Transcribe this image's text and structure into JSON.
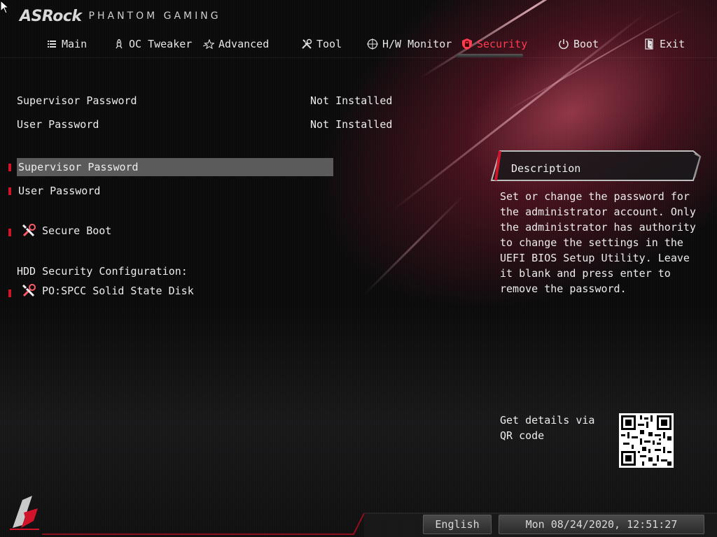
{
  "branding": {
    "name": "ASRock",
    "subtitle": "PHANTOM GAMING"
  },
  "tabs": [
    {
      "label": "Main",
      "icon": "list-icon",
      "active": false
    },
    {
      "label": "OC Tweaker",
      "icon": "rocket-icon",
      "active": false
    },
    {
      "label": "Advanced",
      "icon": "star-icon",
      "active": false
    },
    {
      "label": "Tool",
      "icon": "tools-icon",
      "active": false
    },
    {
      "label": "H/W Monitor",
      "icon": "target-icon",
      "active": false
    },
    {
      "label": "Security",
      "icon": "shield-icon",
      "active": true
    },
    {
      "label": "Boot",
      "icon": "power-icon",
      "active": false
    },
    {
      "label": "Exit",
      "icon": "exit-door-icon",
      "active": false
    }
  ],
  "status": [
    {
      "label": "Supervisor Password",
      "value": "Not Installed"
    },
    {
      "label": "User Password",
      "value": "Not Installed"
    }
  ],
  "menu": {
    "supervisor_password": "Supervisor Password",
    "user_password": "User Password",
    "secure_boot": "Secure Boot",
    "hdd_section_label": "HDD Security Configuration:",
    "hdd_device": "PO:SPCC Solid State Disk"
  },
  "description": {
    "title": "Description",
    "text": "Set or change the password for the administrator account. Only the administrator has authority to change the settings in the UEFI BIOS Setup Utility. Leave it blank and press enter to remove the password."
  },
  "qr": {
    "caption": "Get details via QR code"
  },
  "footer": {
    "language": "English",
    "datetime": "Mon 08/24/2020, 12:51:27"
  },
  "colors": {
    "accent": "#d2142a",
    "active_tab": "#ff3b4e",
    "selected_bg": "#5b5b5b"
  }
}
